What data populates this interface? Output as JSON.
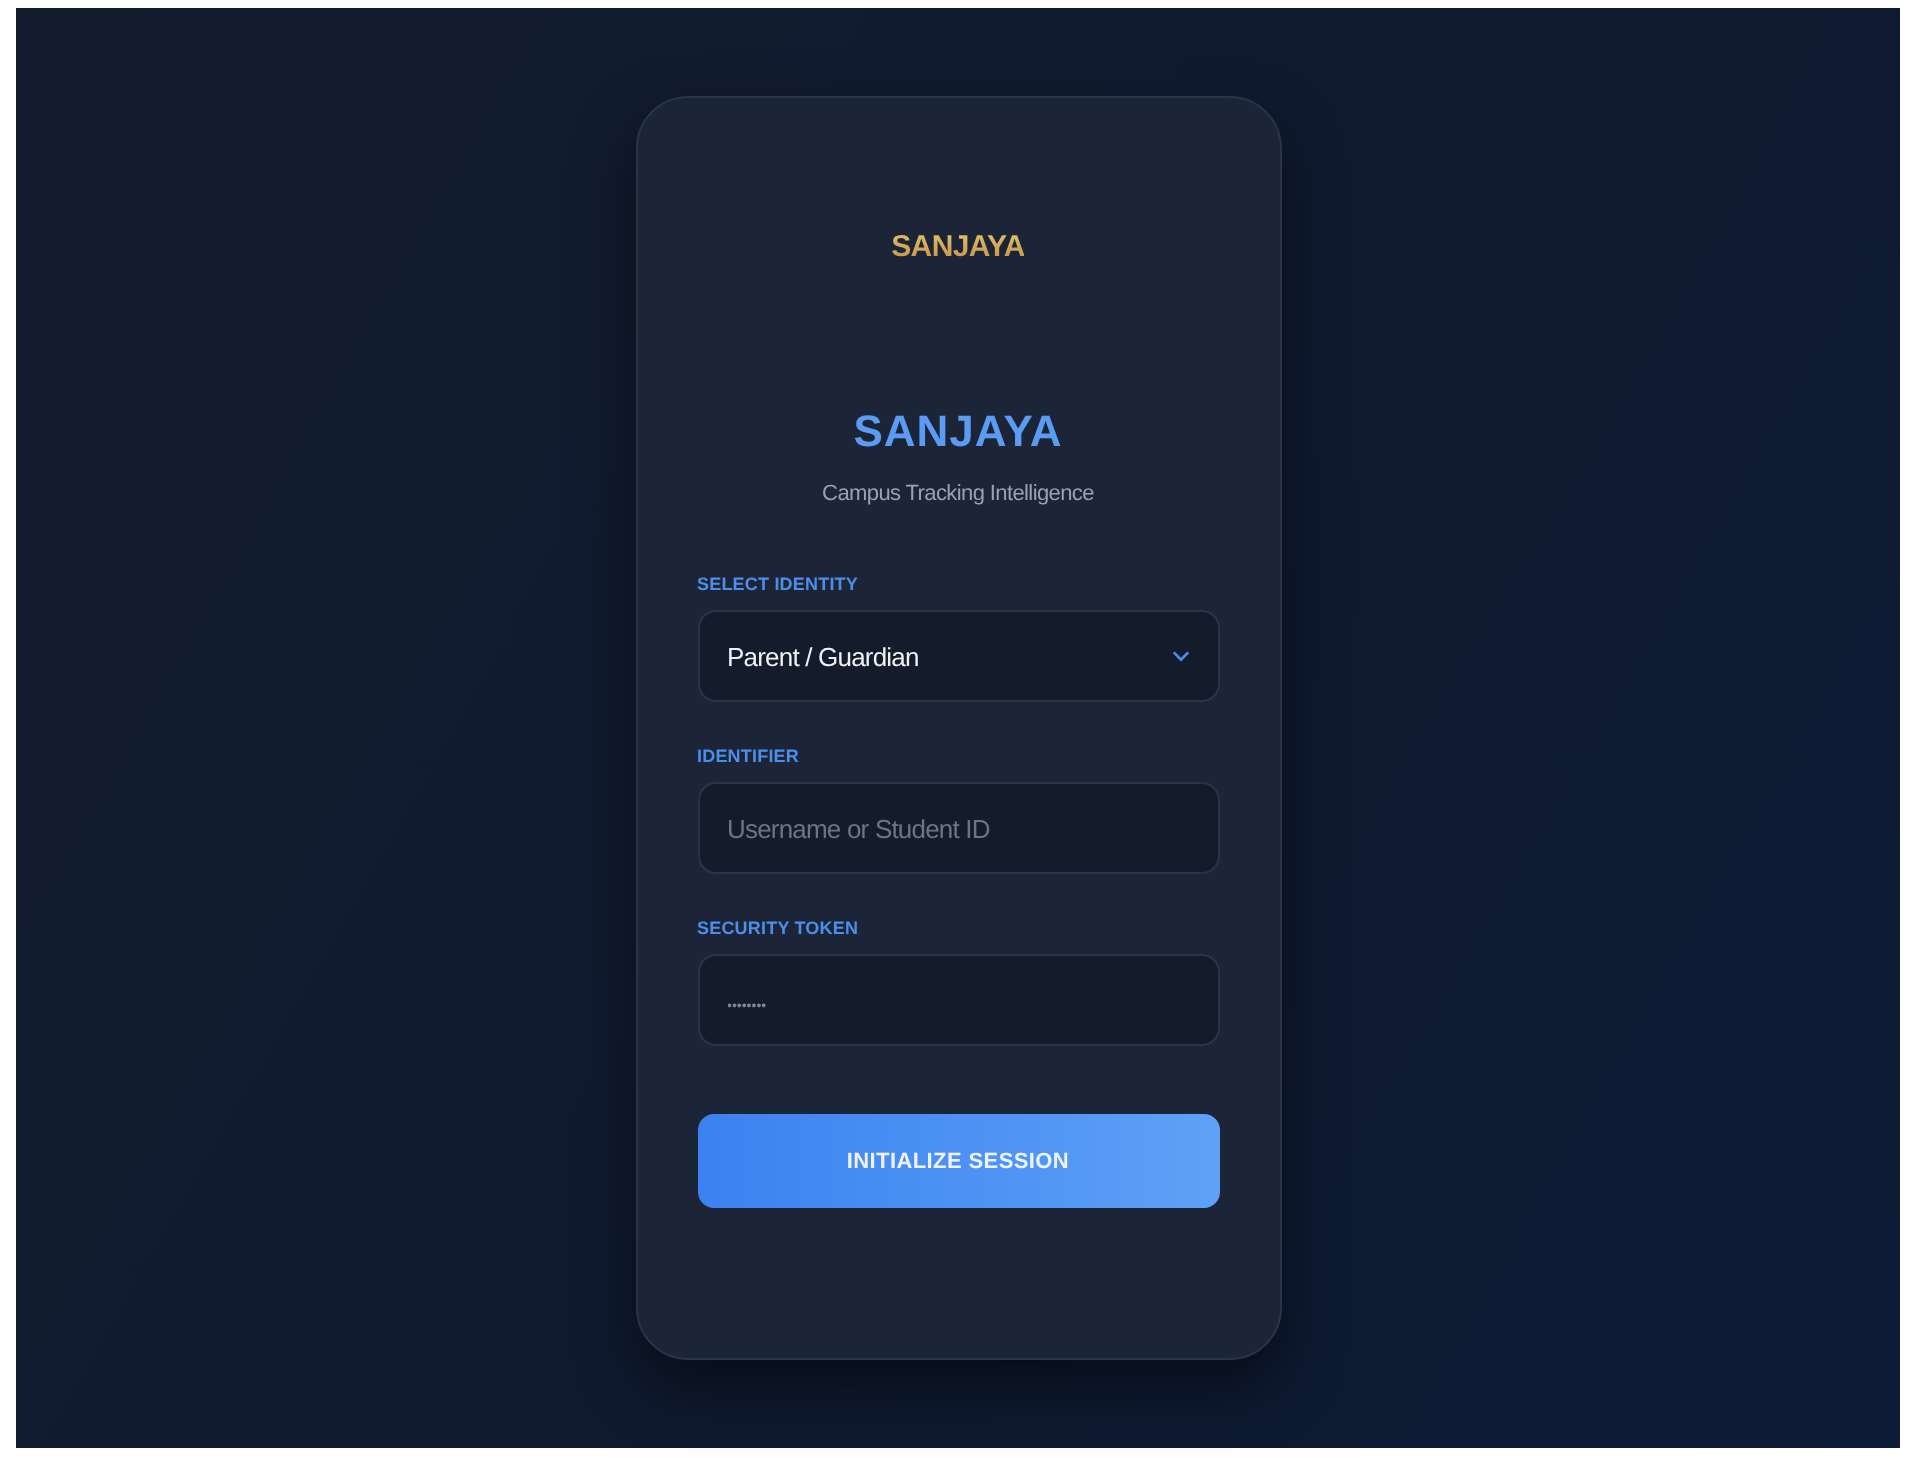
{
  "logo": {
    "text": "SANJAYA"
  },
  "title": "SANJAYA",
  "subtitle": "Campus Tracking Intelligence",
  "fields": [
    {
      "kind": "select",
      "label": "SELECT IDENTITY",
      "value": "Parent / Guardian"
    },
    {
      "kind": "text",
      "label": "IDENTIFIER",
      "placeholder": "Username or Student ID"
    },
    {
      "kind": "password",
      "label": "SECURITY TOKEN",
      "placeholder": "••••••••"
    }
  ],
  "button": "INITIALIZE SESSION"
}
